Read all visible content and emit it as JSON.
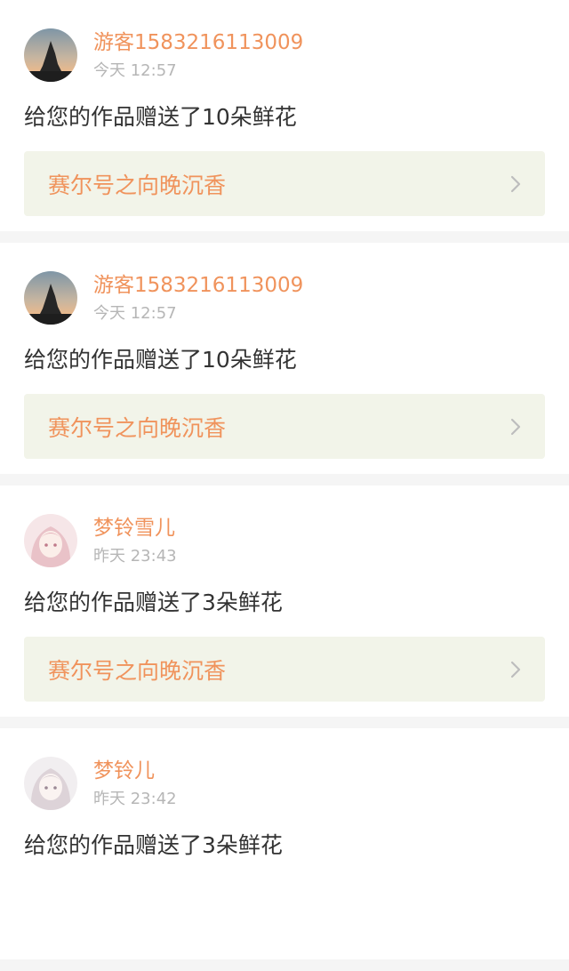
{
  "feed": {
    "items": [
      {
        "username": "游客1583216113009",
        "time": "今天 12:57",
        "message": "给您的作品赠送了10朵鲜花",
        "work_title": "赛尔号之向晚沉香",
        "avatar_icon": "sunset-tree-avatar"
      },
      {
        "username": "游客1583216113009",
        "time": "今天 12:57",
        "message": "给您的作品赠送了10朵鲜花",
        "work_title": "赛尔号之向晚沉香",
        "avatar_icon": "sunset-tree-avatar"
      },
      {
        "username": "梦铃雪儿",
        "time": "昨天 23:43",
        "message": "给您的作品赠送了3朵鲜花",
        "work_title": "赛尔号之向晚沉香",
        "avatar_icon": "anime-girl-pink-avatar"
      },
      {
        "username": "梦铃儿",
        "time": "昨天 23:42",
        "message": "给您的作品赠送了3朵鲜花",
        "work_title": "",
        "avatar_icon": "anime-girl-white-avatar"
      }
    ]
  },
  "colors": {
    "accent": "#f0935c",
    "tab_indicator": "#e8769a",
    "link_background": "#f2f4e9"
  }
}
